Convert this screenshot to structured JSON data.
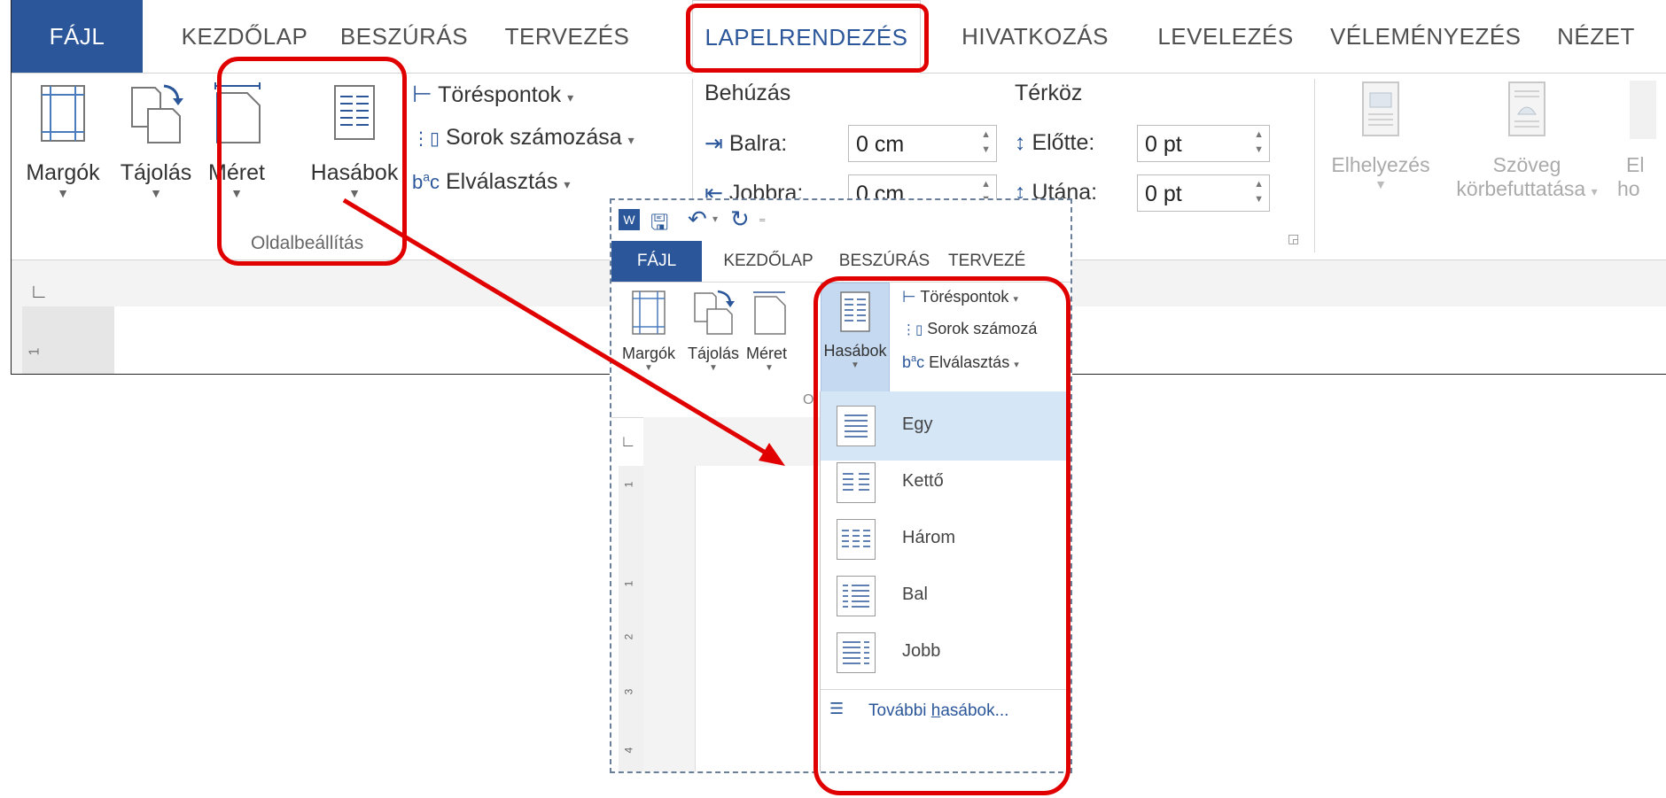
{
  "big": {
    "tabs": [
      "FÁJL",
      "KEZDŐLAP",
      "BESZÚRÁS",
      "TERVEZÉS",
      "LAPELRENDEZÉS",
      "HIVATKOZÁS",
      "LEVELEZÉS",
      "VÉLEMÉNYEZÉS",
      "NÉZET"
    ],
    "buttons": {
      "margins": "Margók",
      "orientation": "Tájolás",
      "size": "Méret",
      "columns": "Hasábok"
    },
    "small": {
      "breaks": "Töréspontok",
      "line_numbers": "Sorok számozása",
      "hyphenation": "Elválasztás"
    },
    "group_page_setup": "Oldalbeállítás",
    "indent": {
      "title": "Behúzás",
      "left_label": "Balra:",
      "left_value": "0 cm",
      "right_label": "Jobbra:",
      "right_value": "0 cm"
    },
    "spacing": {
      "title": "Térköz",
      "before_label": "Előtte:",
      "before_value": "0 pt",
      "after_label": "Utána:",
      "after_value": "0 pt"
    },
    "arrange": {
      "position": "Elhelyezés",
      "wrap_line1": "Szöveg",
      "wrap_line2": "körbefuttatása",
      "bring_line1": "El",
      "bring_line2": "ho"
    }
  },
  "inset": {
    "tabs": [
      "FÁJL",
      "KEZDŐLAP",
      "BESZÚRÁS",
      "TERVEZÉ"
    ],
    "buttons": {
      "margins": "Margók",
      "orientation": "Tájolás",
      "size": "Méret",
      "columns": "Hasábok"
    },
    "small": {
      "breaks": "Töréspontok",
      "line_numbers": "Sorok számozá",
      "hyphenation": "Elválasztás"
    },
    "group_partial": "Ol",
    "dropdown": [
      "Egy",
      "Kettő",
      "Három",
      "Bal",
      "Jobb"
    ],
    "more_columns_pre": "További ",
    "more_columns_u": "h",
    "more_columns_post": "asábok..."
  },
  "ruler": {
    "marks": [
      "1",
      "1",
      "2",
      "3",
      "4"
    ]
  },
  "colors": {
    "file_tab": "#2b579a",
    "annotation_red": "#e10000",
    "accent_text": "#2b579a"
  }
}
